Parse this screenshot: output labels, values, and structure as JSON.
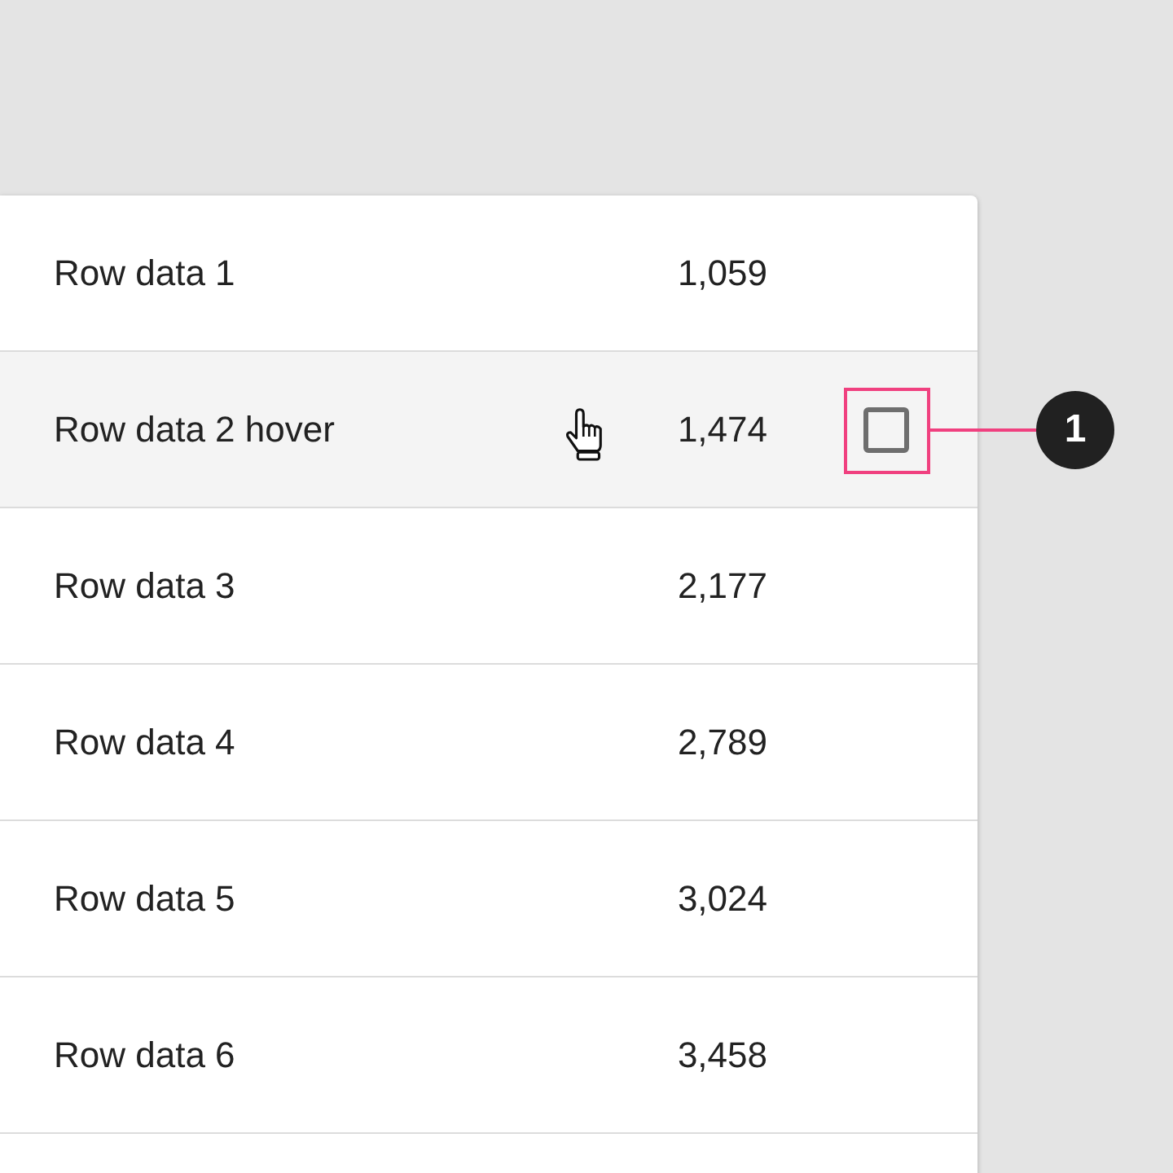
{
  "rows": [
    {
      "label": "Row data 1",
      "value": "1,059",
      "hovered": false
    },
    {
      "label": "Row data 2 hover",
      "value": "1,474",
      "hovered": true,
      "checkbox": {
        "checked": false
      },
      "callout": "1"
    },
    {
      "label": "Row data 3",
      "value": "2,177",
      "hovered": false
    },
    {
      "label": "Row data 4",
      "value": "2,789",
      "hovered": false
    },
    {
      "label": "Row data 5",
      "value": "3,024",
      "hovered": false
    },
    {
      "label": "Row data 6",
      "value": "3,458",
      "hovered": false
    }
  ]
}
